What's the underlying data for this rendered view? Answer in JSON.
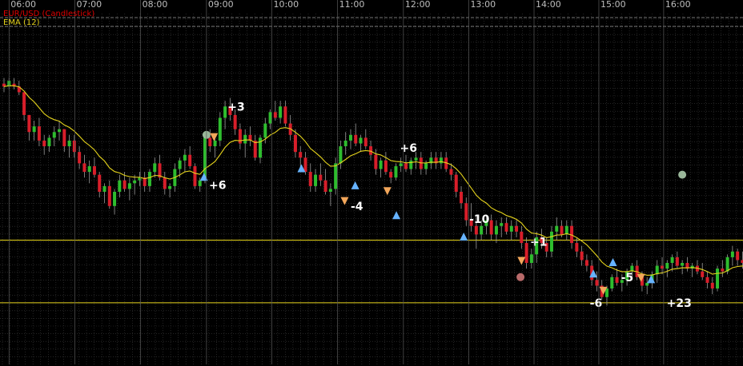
{
  "legend": {
    "symbol": "EUR/USD (Candlestick)",
    "indicator": "EMA (12)"
  },
  "colors": {
    "background": "#000000",
    "grid": "#3b3b3b",
    "bull": "#2ebd2e",
    "bear": "#d81e2a",
    "ema": "#e6d41c",
    "hline": "#e6d41c",
    "legend_symbol": "#e00000",
    "legend_indicator": "#e6d41c",
    "buy_marker": "#66b3ff",
    "sell_marker": "#f2a65a",
    "exit_marker": "#9ab79a",
    "exit_marker_alt": "#b86a6a"
  },
  "time_labels": [
    "06:00",
    "07:00",
    "08:00",
    "09:00",
    "10:00",
    "11:00",
    "12:00",
    "13:00",
    "14:00",
    "15:00",
    "16:00"
  ],
  "chart_data": {
    "type": "candlestick",
    "price_range": [
      0,
      100
    ],
    "time_range": [
      0,
      153
    ],
    "time_tick_positions": [
      1,
      14.1,
      27.2,
      40.3,
      53.3,
      66.4,
      79.5,
      92.5,
      105.5,
      118.4,
      131.3
    ],
    "ema_period": 12,
    "horizontal_lines": [
      33,
      11
    ],
    "candles": [
      [
        88,
        90,
        85,
        87
      ],
      [
        87,
        90,
        86,
        89
      ],
      [
        88,
        90,
        86,
        87
      ],
      [
        87,
        89,
        84,
        85
      ],
      [
        85,
        85,
        75,
        77
      ],
      [
        77,
        77,
        68,
        71
      ],
      [
        71,
        75,
        68,
        73
      ],
      [
        73,
        76,
        66,
        68
      ],
      [
        68,
        70,
        63,
        66
      ],
      [
        66,
        70,
        64,
        69
      ],
      [
        69,
        73,
        66,
        71
      ],
      [
        71,
        75,
        68,
        72
      ],
      [
        72,
        72,
        64,
        66
      ],
      [
        66,
        70,
        62,
        68
      ],
      [
        68,
        70,
        62,
        64
      ],
      [
        64,
        66,
        58,
        60
      ],
      [
        60,
        63,
        55,
        57
      ],
      [
        57,
        61,
        53,
        59
      ],
      [
        59,
        62,
        55,
        56
      ],
      [
        56,
        57,
        48,
        50
      ],
      [
        50,
        53,
        46,
        52
      ],
      [
        52,
        54,
        44,
        45
      ],
      [
        45,
        51,
        42,
        50
      ],
      [
        50,
        56,
        48,
        54
      ],
      [
        54,
        57,
        50,
        51
      ],
      [
        51,
        55,
        47,
        53
      ],
      [
        53,
        56,
        49,
        54
      ],
      [
        54,
        57,
        52,
        55
      ],
      [
        55,
        57,
        50,
        52
      ],
      [
        52,
        58,
        50,
        57
      ],
      [
        57,
        62,
        55,
        60
      ],
      [
        60,
        63,
        54,
        55
      ],
      [
        55,
        57,
        49,
        51
      ],
      [
        51,
        53,
        48,
        52
      ],
      [
        52,
        60,
        50,
        58
      ],
      [
        58,
        62,
        55,
        61
      ],
      [
        61,
        65,
        57,
        63
      ],
      [
        63,
        66,
        58,
        59
      ],
      [
        59,
        60,
        51,
        52
      ],
      [
        52,
        55,
        50,
        54
      ],
      [
        54,
        71,
        53,
        69
      ],
      [
        69,
        72,
        64,
        66
      ],
      [
        66,
        70,
        62,
        68
      ],
      [
        68,
        78,
        66,
        76
      ],
      [
        76,
        82,
        72,
        80
      ],
      [
        80,
        83,
        75,
        77
      ],
      [
        77,
        79,
        70,
        72
      ],
      [
        72,
        74,
        65,
        67
      ],
      [
        67,
        72,
        62,
        70
      ],
      [
        70,
        73,
        66,
        68
      ],
      [
        68,
        70,
        61,
        62
      ],
      [
        62,
        70,
        60,
        69
      ],
      [
        69,
        76,
        67,
        74
      ],
      [
        74,
        79,
        72,
        78
      ],
      [
        78,
        82,
        75,
        76
      ],
      [
        76,
        82,
        74,
        80
      ],
      [
        80,
        82,
        73,
        74
      ],
      [
        74,
        77,
        68,
        70
      ],
      [
        70,
        72,
        62,
        64
      ],
      [
        64,
        66,
        58,
        62
      ],
      [
        62,
        64,
        56,
        57
      ],
      [
        57,
        60,
        50,
        52
      ],
      [
        52,
        58,
        50,
        56
      ],
      [
        56,
        60,
        52,
        54
      ],
      [
        54,
        58,
        49,
        50
      ],
      [
        50,
        53,
        45,
        51
      ],
      [
        51,
        62,
        49,
        60
      ],
      [
        60,
        68,
        58,
        66
      ],
      [
        66,
        71,
        63,
        68
      ],
      [
        68,
        72,
        65,
        70
      ],
      [
        70,
        74,
        66,
        67
      ],
      [
        67,
        70,
        64,
        69
      ],
      [
        69,
        72,
        65,
        66
      ],
      [
        66,
        68,
        61,
        63
      ],
      [
        63,
        65,
        56,
        58
      ],
      [
        58,
        62,
        55,
        61
      ],
      [
        61,
        64,
        56,
        57
      ],
      [
        57,
        58,
        53,
        55
      ],
      [
        55,
        60,
        54,
        59
      ],
      [
        59,
        62,
        57,
        60
      ],
      [
        60,
        63,
        57,
        58
      ],
      [
        58,
        62,
        56,
        61
      ],
      [
        61,
        64,
        58,
        62
      ],
      [
        62,
        64,
        56,
        58
      ],
      [
        58,
        61,
        56,
        60
      ],
      [
        60,
        64,
        58,
        62
      ],
      [
        62,
        64,
        58,
        60
      ],
      [
        60,
        64,
        58,
        62
      ],
      [
        62,
        64,
        57,
        58
      ],
      [
        58,
        60,
        54,
        56
      ],
      [
        56,
        57,
        48,
        50
      ],
      [
        50,
        52,
        44,
        46
      ],
      [
        46,
        48,
        38,
        40
      ],
      [
        40,
        46,
        36,
        38
      ],
      [
        38,
        42,
        30,
        35
      ],
      [
        35,
        40,
        33,
        38
      ],
      [
        38,
        42,
        35,
        40
      ],
      [
        40,
        42,
        33,
        35
      ],
      [
        35,
        40,
        32,
        38
      ],
      [
        38,
        41,
        34,
        39
      ],
      [
        39,
        41,
        35,
        36
      ],
      [
        36,
        40,
        33,
        38
      ],
      [
        38,
        40,
        34,
        36
      ],
      [
        36,
        38,
        30,
        32
      ],
      [
        32,
        34,
        23,
        25
      ],
      [
        25,
        30,
        23,
        28
      ],
      [
        28,
        36,
        25,
        34
      ],
      [
        34,
        37,
        30,
        32
      ],
      [
        32,
        34,
        27,
        29
      ],
      [
        29,
        38,
        27,
        36
      ],
      [
        36,
        41,
        33,
        38
      ],
      [
        38,
        40,
        34,
        35
      ],
      [
        35,
        40,
        33,
        38
      ],
      [
        38,
        40,
        30,
        32
      ],
      [
        32,
        34,
        27,
        29
      ],
      [
        29,
        31,
        24,
        26
      ],
      [
        26,
        28,
        22,
        24
      ],
      [
        24,
        26,
        17,
        19
      ],
      [
        19,
        22,
        15,
        17
      ],
      [
        17,
        19,
        12,
        13
      ],
      [
        13,
        17,
        10,
        16
      ],
      [
        16,
        21,
        15,
        20
      ],
      [
        20,
        23,
        17,
        18
      ],
      [
        18,
        21,
        15,
        19
      ],
      [
        19,
        23,
        17,
        22
      ],
      [
        22,
        25,
        20,
        24
      ],
      [
        24,
        26,
        19,
        20
      ],
      [
        20,
        22,
        15,
        17
      ],
      [
        17,
        20,
        14,
        18
      ],
      [
        18,
        22,
        16,
        21
      ],
      [
        21,
        26,
        18,
        24
      ],
      [
        24,
        27,
        21,
        23
      ],
      [
        23,
        26,
        20,
        25
      ],
      [
        25,
        28,
        22,
        27
      ],
      [
        27,
        29,
        23,
        24
      ],
      [
        24,
        26,
        21,
        25
      ],
      [
        25,
        27,
        22,
        23
      ],
      [
        23,
        25,
        20,
        24
      ],
      [
        24,
        26,
        21,
        22
      ],
      [
        22,
        25,
        19,
        20
      ],
      [
        20,
        22,
        16,
        18
      ],
      [
        18,
        20,
        14,
        16
      ],
      [
        16,
        24,
        15,
        23
      ],
      [
        23,
        26,
        20,
        22
      ],
      [
        22,
        28,
        21,
        27
      ],
      [
        27,
        31,
        24,
        29
      ],
      [
        29,
        30,
        24,
        26
      ],
      [
        26,
        29,
        23,
        25
      ],
      [
        25,
        27,
        19,
        21
      ],
      [
        21,
        22,
        10,
        12
      ],
      [
        12,
        20,
        9,
        19
      ],
      [
        19,
        24,
        17,
        23
      ],
      [
        23,
        30,
        22,
        28
      ],
      [
        28,
        36,
        26,
        34
      ],
      [
        34,
        50,
        33,
        48
      ],
      [
        48,
        62,
        46,
        60
      ],
      [
        60,
        68,
        58,
        66
      ],
      [
        66,
        70,
        62,
        64
      ],
      [
        64,
        70,
        62,
        68
      ],
      [
        68,
        69,
        62,
        63
      ]
    ],
    "markers": [
      {
        "kind": "exit",
        "t": 40.3,
        "p": 70
      },
      {
        "kind": "sell",
        "t": 41.8,
        "p": 69.5
      },
      {
        "kind": "buy",
        "t": 39.8,
        "p": 55
      },
      {
        "kind": "buy",
        "t": 59.2,
        "p": 58
      },
      {
        "kind": "buy",
        "t": 69.9,
        "p": 52
      },
      {
        "kind": "sell",
        "t": 67.8,
        "p": 47
      },
      {
        "kind": "sell",
        "t": 76.3,
        "p": 50.5
      },
      {
        "kind": "buy",
        "t": 78.1,
        "p": 41.5
      },
      {
        "kind": "buy",
        "t": 91.5,
        "p": 34
      },
      {
        "kind": "sell",
        "t": 103,
        "p": 26
      },
      {
        "kind": "exit_alt",
        "t": 102.8,
        "p": 20
      },
      {
        "kind": "buy",
        "t": 117.3,
        "p": 21
      },
      {
        "kind": "sell",
        "t": 119.3,
        "p": 15.5
      },
      {
        "kind": "buy",
        "t": 121.2,
        "p": 25
      },
      {
        "kind": "sell",
        "t": 126.8,
        "p": 20
      },
      {
        "kind": "buy",
        "t": 128.8,
        "p": 19
      },
      {
        "kind": "exit",
        "t": 135,
        "p": 56
      }
    ],
    "trade_labels": [
      {
        "text": "+3",
        "t": 44.5,
        "p": 78.5
      },
      {
        "text": "+6",
        "t": 40.8,
        "p": 51
      },
      {
        "text": "-4",
        "t": 69,
        "p": 43.5
      },
      {
        "text": "+6",
        "t": 78.8,
        "p": 64
      },
      {
        "text": "-10",
        "t": 92.6,
        "p": 39
      },
      {
        "text": "+1",
        "t": 104.7,
        "p": 31
      },
      {
        "text": "-5",
        "t": 122.8,
        "p": 18.5
      },
      {
        "text": "-6",
        "t": 116.6,
        "p": 9.5
      },
      {
        "text": "+23",
        "t": 131.9,
        "p": 9.5
      }
    ]
  }
}
